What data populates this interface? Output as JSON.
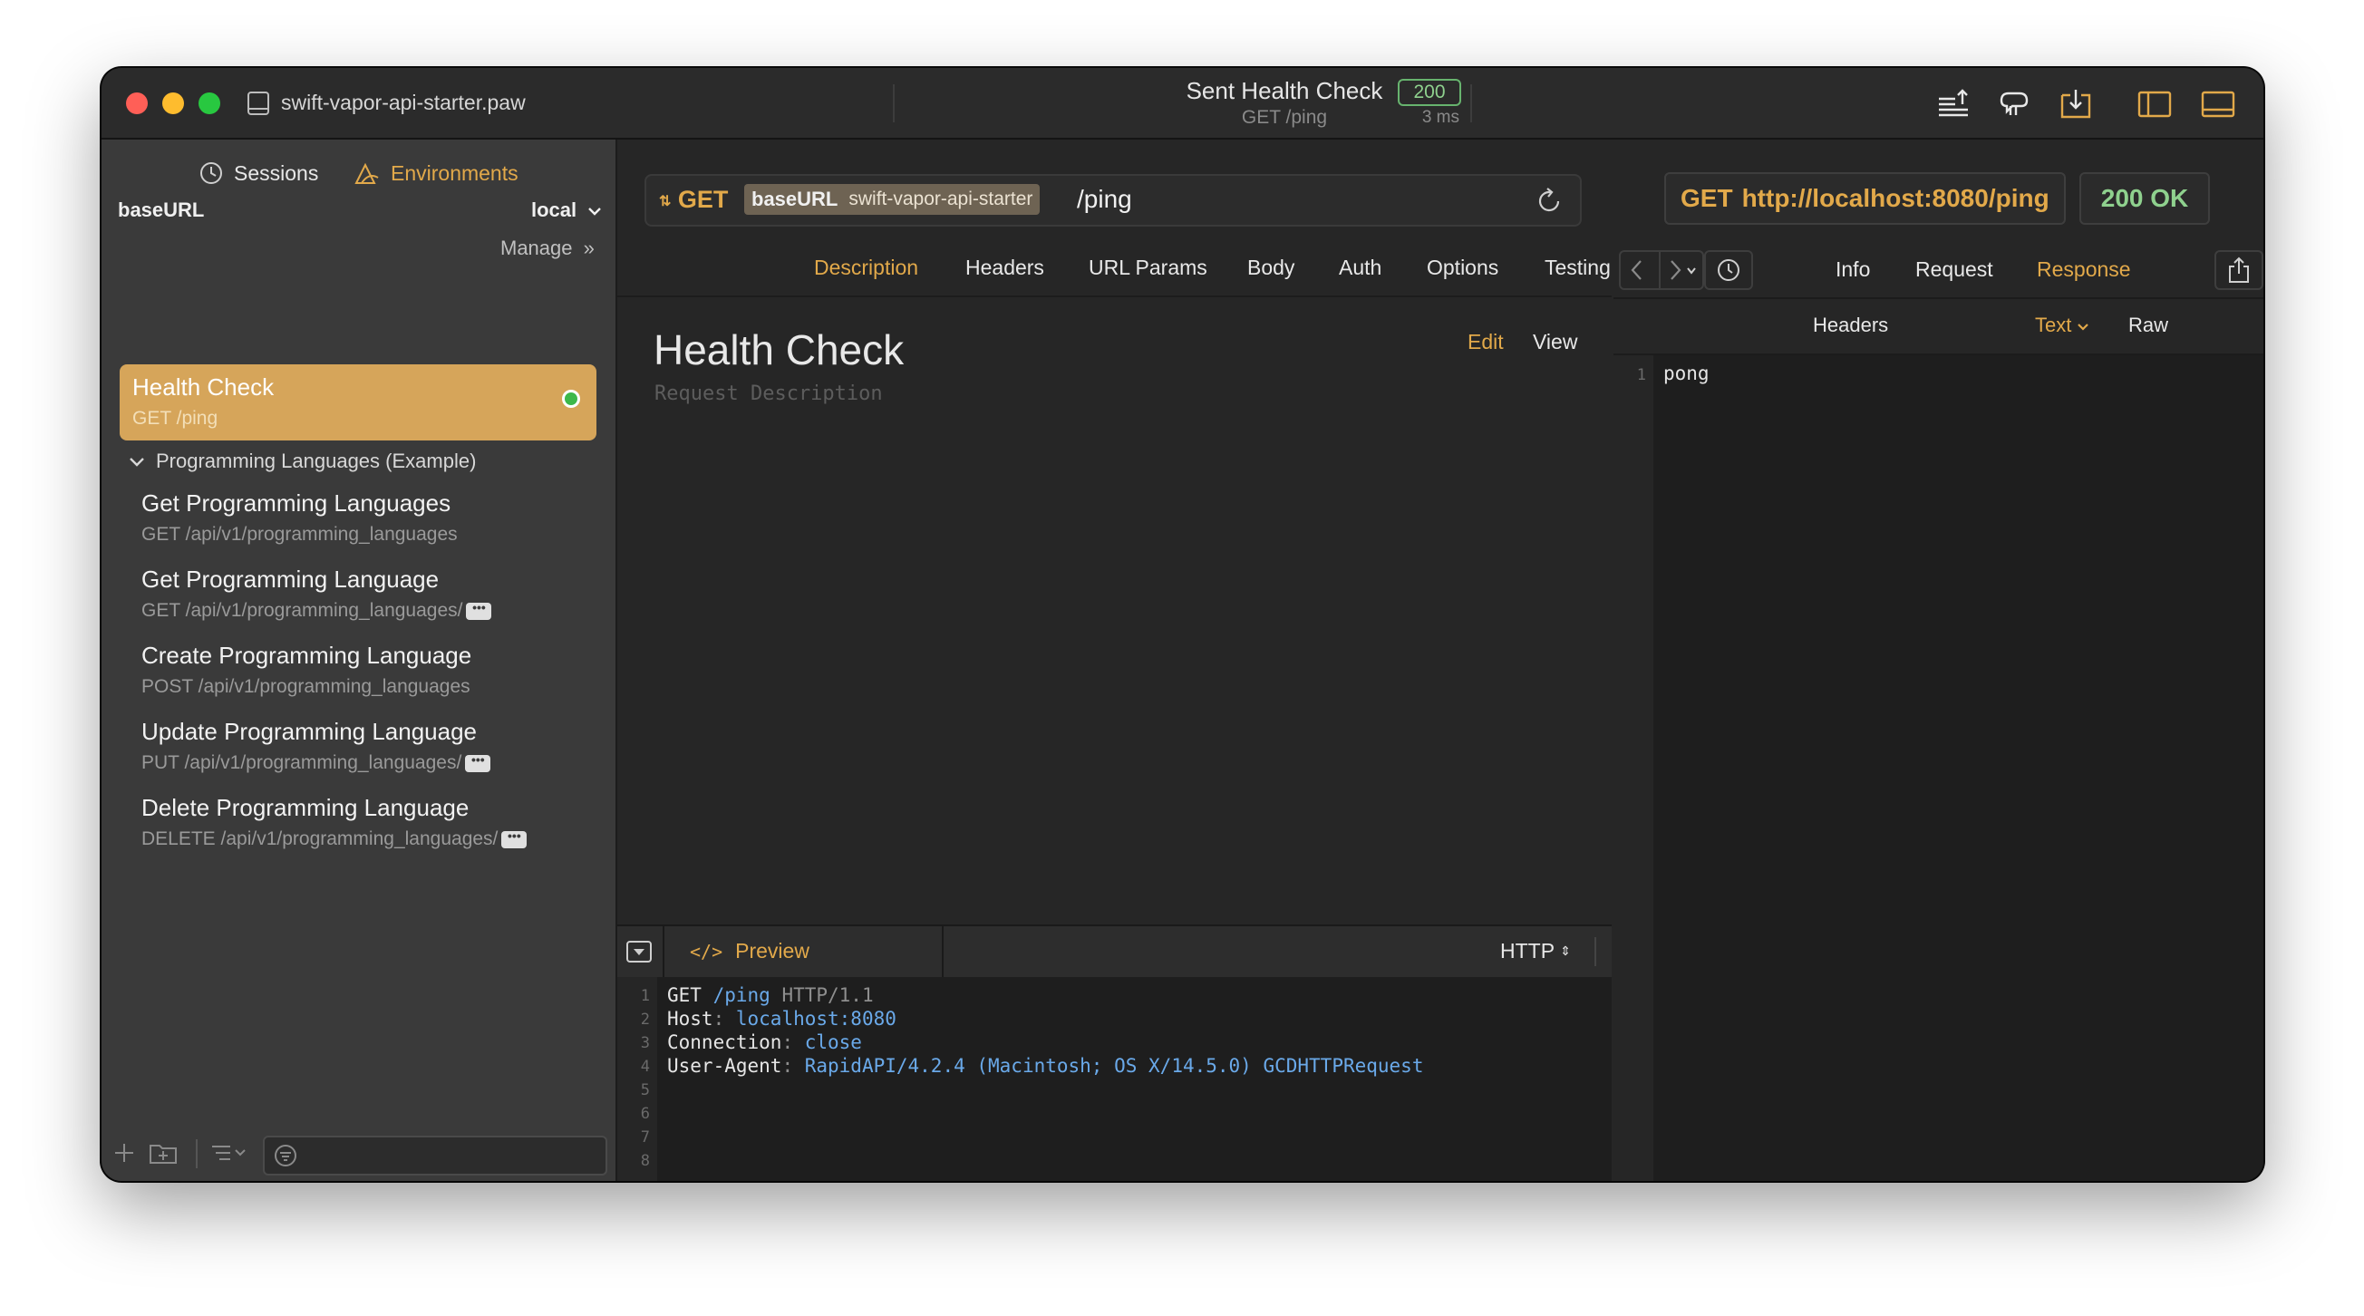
{
  "window": {
    "document_name": "swift-vapor-api-starter.paw",
    "title": "Sent Health Check",
    "subtitle": "GET /ping",
    "status_code": "200",
    "duration": "3 ms"
  },
  "sidebar": {
    "tabs": [
      {
        "label": "Sessions",
        "icon": "history-icon",
        "active": false
      },
      {
        "label": "Environments",
        "icon": "environments-icon",
        "active": true
      }
    ],
    "env_variable": "baseURL",
    "env_value": "local",
    "manage_label": "Manage",
    "active_request": {
      "name": "Health Check",
      "subtitle": "GET /ping",
      "status": "success"
    },
    "group_name": "Programming Languages (Example)",
    "requests": [
      {
        "name": "Get Programming Languages",
        "subtitle": "GET /api/v1/programming_languages",
        "has_param": false
      },
      {
        "name": "Get Programming Language",
        "subtitle": "GET /api/v1/programming_languages/",
        "has_param": true
      },
      {
        "name": "Create Programming Language",
        "subtitle": "POST /api/v1/programming_languages",
        "has_param": false
      },
      {
        "name": "Update Programming Language",
        "subtitle": "PUT /api/v1/programming_languages/",
        "has_param": true
      },
      {
        "name": "Delete Programming Language",
        "subtitle": "DELETE /api/v1/programming_languages/",
        "has_param": true
      }
    ],
    "param_token": "•••"
  },
  "request": {
    "method": "GET",
    "url_var_key": "baseURL",
    "url_var_value": "swift-vapor-api-starter",
    "url_path": "/ping",
    "tabs": [
      "Description",
      "Headers",
      "URL Params",
      "Body",
      "Auth",
      "Options",
      "Testing"
    ],
    "active_tab": "Description",
    "title": "Health Check",
    "description_placeholder": "Request Description",
    "edit_label": "Edit",
    "view_label": "View"
  },
  "preview": {
    "label": "Preview",
    "format": "HTTP",
    "format_arrows": "⌃⌄",
    "lines": [
      {
        "n": "1",
        "parts": [
          {
            "t": "GET ",
            "c": "w"
          },
          {
            "t": "/ping",
            "c": "b"
          },
          {
            "t": " HTTP/1.1",
            "c": "g"
          }
        ]
      },
      {
        "n": "2",
        "parts": [
          {
            "t": "Host",
            "c": "w"
          },
          {
            "t": ": ",
            "c": "g"
          },
          {
            "t": "localhost:8080",
            "c": "b"
          }
        ]
      },
      {
        "n": "3",
        "parts": [
          {
            "t": "Connection",
            "c": "w"
          },
          {
            "t": ": ",
            "c": "g"
          },
          {
            "t": "close",
            "c": "b"
          }
        ]
      },
      {
        "n": "4",
        "parts": [
          {
            "t": "User-Agent",
            "c": "w"
          },
          {
            "t": ": ",
            "c": "g"
          },
          {
            "t": "RapidAPI/4.2.4 (Macintosh; OS X/14.5.0) GCDHTTPRequest",
            "c": "b"
          }
        ]
      },
      {
        "n": "5",
        "parts": []
      },
      {
        "n": "6",
        "parts": []
      },
      {
        "n": "7",
        "parts": []
      },
      {
        "n": "8",
        "parts": []
      }
    ]
  },
  "response": {
    "method": "GET",
    "url": "http://localhost:8080/ping",
    "status": "200 OK",
    "tabs": [
      "Info",
      "Request",
      "Response"
    ],
    "active_tab": "Response",
    "subtabs": [
      "Headers",
      "Text",
      "Raw"
    ],
    "active_subtab": "Text",
    "body_lines": [
      {
        "n": "1",
        "text": "pong"
      }
    ]
  },
  "colors": {
    "accent": "#e2a94a",
    "success": "#8fd18e",
    "link_blue": "#6aa9e9"
  }
}
